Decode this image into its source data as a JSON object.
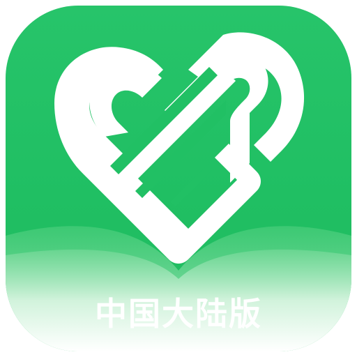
{
  "app_icon": {
    "logo_icon": "green-heart-book-icon",
    "region_label": "中国大陆版",
    "colors": {
      "background": "#22c166",
      "heart": "#ffffff",
      "book_pages": "#e9f8ee"
    }
  }
}
